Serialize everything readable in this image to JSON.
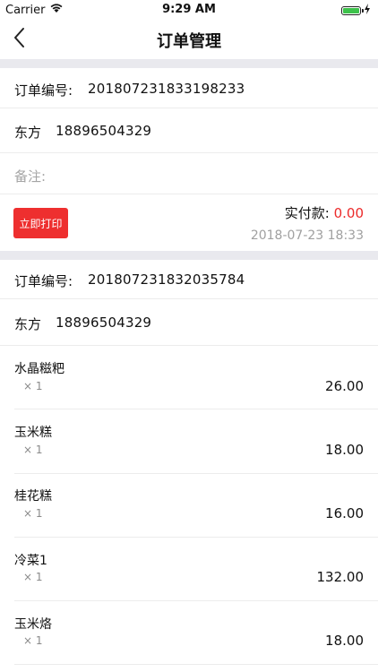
{
  "status_bar": {
    "carrier": "Carrier",
    "time": "9:29 AM"
  },
  "nav": {
    "title": "订单管理"
  },
  "order1": {
    "order_no_label": "订单编号:",
    "order_no": "201807231833198233",
    "customer": "东方",
    "phone": "18896504329",
    "remark_label": "备注:",
    "print_label": "立即打印",
    "paid_label": "实付款:",
    "paid_amount": "0.00",
    "date": "2018-07-23 18:33"
  },
  "order2": {
    "order_no_label": "订单编号:",
    "order_no": "201807231832035784",
    "customer": "东方",
    "phone": "18896504329",
    "items": [
      {
        "name": "水晶糍粑",
        "qty": "× 1",
        "price": "26.00"
      },
      {
        "name": "玉米糕",
        "qty": "× 1",
        "price": "18.00"
      },
      {
        "name": "桂花糕",
        "qty": "× 1",
        "price": "16.00"
      },
      {
        "name": "冷菜1",
        "qty": "× 1",
        "price": "132.00"
      },
      {
        "name": "玉米烙",
        "qty": "× 1",
        "price": "18.00"
      }
    ]
  },
  "colors": {
    "accent_red": "#ee2f2f",
    "battery_green": "#3dc24b"
  }
}
